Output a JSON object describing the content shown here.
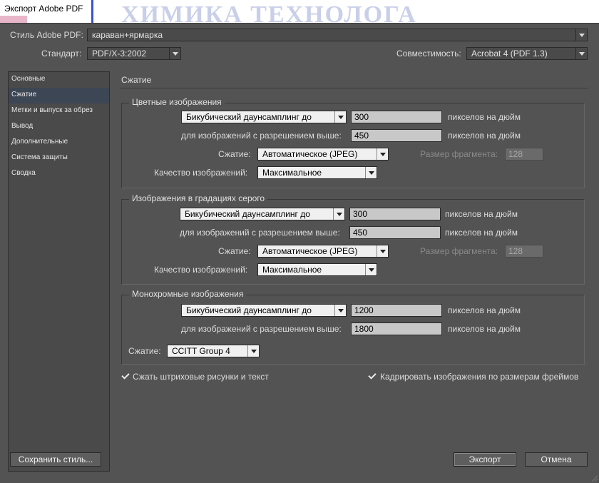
{
  "window": {
    "title": "Экспорт Adobe PDF",
    "background_text": "ХИМИКА ТЕХНОЛОГА"
  },
  "header": {
    "style_label": "Стиль Adobe PDF:",
    "style_value": "караван+ярмарка",
    "standard_label": "Стандарт:",
    "standard_value": "PDF/X-3:2002",
    "compat_label": "Совместимость:",
    "compat_value": "Acrobat 4 (PDF 1.3)"
  },
  "sidebar": {
    "items": [
      {
        "label": "Основные"
      },
      {
        "label": "Сжатие"
      },
      {
        "label": "Метки и выпуск за обрез"
      },
      {
        "label": "Вывод"
      },
      {
        "label": "Дополнительные"
      },
      {
        "label": "Система защиты"
      },
      {
        "label": "Сводка"
      }
    ],
    "selected": "Сжатие"
  },
  "main": {
    "section_title": "Сжатие",
    "color": {
      "title": "Цветные изображения",
      "method": "Бикубический даунсамплинг до",
      "ppi": "300",
      "ppi_unit": "пикселов на дюйм",
      "above_label": "для изображений с разрешением выше:",
      "above_value": "450",
      "above_unit": "пикселов на дюйм",
      "compression_label": "Сжатие:",
      "compression_value": "Автоматическое (JPEG)",
      "tile_label": "Размер фрагмента:",
      "tile_value": "128",
      "quality_label": "Качество изображений:",
      "quality_value": "Максимальное"
    },
    "gray": {
      "title": "Изображения в градациях серого",
      "method": "Бикубический даунсамплинг до",
      "ppi": "300",
      "ppi_unit": "пикселов на дюйм",
      "above_label": "для изображений с разрешением выше:",
      "above_value": "450",
      "above_unit": "пикселов на дюйм",
      "compression_label": "Сжатие:",
      "compression_value": "Автоматическое (JPEG)",
      "tile_label": "Размер фрагмента:",
      "tile_value": "128",
      "quality_label": "Качество изображений:",
      "quality_value": "Максимальное"
    },
    "mono": {
      "title": "Монохромные изображения",
      "method": "Бикубический даунсамплинг до",
      "ppi": "1200",
      "ppi_unit": "пикселов на дюйм",
      "above_label": "для изображений с разрешением выше:",
      "above_value": "1800",
      "above_unit": "пикселов на дюйм",
      "compression_label": "Сжатие:",
      "compression_value": "CCITT Group 4"
    },
    "compress_text_label": "Сжать штриховые рисунки и текст",
    "compress_text_checked": true,
    "crop_label": "Кадрировать изображения по размерам фреймов",
    "crop_checked": true
  },
  "footer": {
    "save_style": "Сохранить стиль...",
    "export": "Экспорт",
    "cancel": "Отмена"
  }
}
